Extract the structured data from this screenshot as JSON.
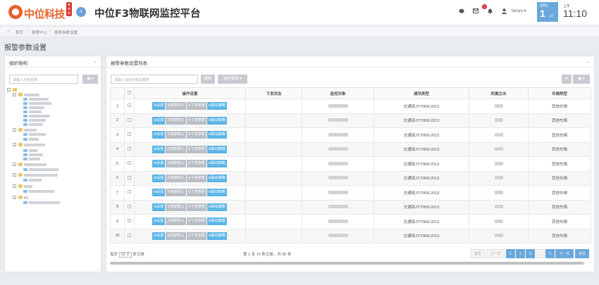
{
  "header": {
    "logo_text": "中位科技",
    "logo_badge": "物联网",
    "menu_toggle": "≡",
    "app_title": "中位F3物联网监控平台",
    "notify_count": "0",
    "user_name": "tianyu",
    "date": {
      "weekday": "星期五",
      "day": "1",
      "month": "2月"
    },
    "time": {
      "ampm": "上午",
      "clock": "11:10"
    }
  },
  "breadcrumb": {
    "home": "首页",
    "parent": "报警中心",
    "current": "报警参数设置"
  },
  "page_title": "报警参数设置",
  "org_panel": {
    "title": "组织架构",
    "search_placeholder": "请输入分组名称",
    "dropdown": "▦ ▾"
  },
  "list_panel": {
    "title": "报警参数设置列表",
    "search_placeholder": "请输入监控对象关键字",
    "search_button": "搜索",
    "batch_menu": "操作菜单 ▾",
    "refresh": "⟳",
    "columns_toggle": "▦ ▾"
  },
  "table": {
    "headers": [
      "",
      "",
      "操作设置",
      "下发状态",
      "监控对象",
      "通讯类型",
      "所属企业",
      "车辆类型"
    ],
    "row_actions": [
      "⊕设置",
      "⊘恢复默认",
      "⊘下发参数",
      "⊕联动策略"
    ],
    "rows": [
      {
        "no": "1",
        "protocol": "交通部JT/T808-2013",
        "vehicle_type": "其他车辆"
      },
      {
        "no": "2",
        "protocol": "交通部JT/T808-2013",
        "vehicle_type": "其他车辆"
      },
      {
        "no": "3",
        "protocol": "交通部JT/T808-2013",
        "vehicle_type": "其他车辆"
      },
      {
        "no": "4",
        "protocol": "交通部JT/T808-2013",
        "vehicle_type": "其他车辆"
      },
      {
        "no": "5",
        "protocol": "交通部JT/T808-2013",
        "vehicle_type": "其他车辆"
      },
      {
        "no": "6",
        "protocol": "交通部JT/T808-2013",
        "vehicle_type": "其他车辆"
      },
      {
        "no": "7",
        "protocol": "交通部JT/T808-2013",
        "vehicle_type": "其他车辆"
      },
      {
        "no": "8",
        "protocol": "交通部JT/T808-2013",
        "vehicle_type": "其他车辆"
      },
      {
        "no": "9",
        "protocol": "交通部JT/T808-2013",
        "vehicle_type": "其他车辆"
      },
      {
        "no": "10",
        "protocol": "交通部JT/T808-2013",
        "vehicle_type": "其他车辆"
      }
    ]
  },
  "footer": {
    "per_page_prefix": "每页",
    "per_page_value": "10",
    "per_page_suffix": "条记录",
    "summary": "第 1 至 10 条记录，共 85 条",
    "pagination": [
      "首页",
      "上一页",
      "1",
      "2",
      "3",
      "...",
      "9",
      "下一页",
      "末页"
    ]
  },
  "colors": {
    "accent_blue": "#6aa8dc",
    "brand_orange": "#e8622c",
    "action_blue": "#5bb5e6",
    "action_grey": "#b9bec5"
  }
}
